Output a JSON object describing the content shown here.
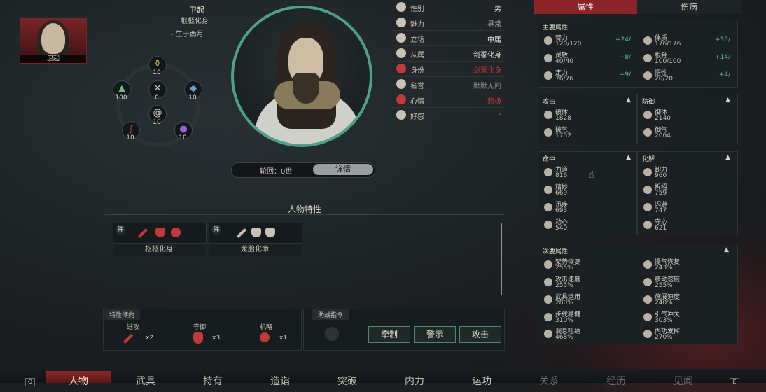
{
  "character": {
    "name": "卫起",
    "title": "枢柩化身",
    "birth": "-  生于酉月",
    "thumb_name": "卫起"
  },
  "wheel": [
    {
      "icon": "gourd-icon",
      "value": "10"
    },
    {
      "icon": "leaf-icon",
      "value": "100"
    },
    {
      "icon": "bird-icon",
      "value": "0"
    },
    {
      "icon": "gem-icon",
      "value": "10"
    },
    {
      "icon": "spiral-icon",
      "value": "10"
    },
    {
      "icon": "snake-icon",
      "value": "10"
    },
    {
      "icon": "flower-icon",
      "value": "10"
    }
  ],
  "reincarnation": {
    "label": "轮回：0世",
    "detail_button": "详情"
  },
  "info": [
    {
      "label": "性别",
      "value": "男",
      "color": "#e6e0d0"
    },
    {
      "label": "魅力",
      "value": "寻常",
      "color": "#c8c2b4"
    },
    {
      "label": "立场",
      "value": "中庸",
      "color": "#e6e0d0"
    },
    {
      "label": "从属",
      "value": "剑冢化身",
      "color": "#e6e0d0"
    },
    {
      "label": "身份",
      "value": "剑冢化身",
      "color": "#c0393b"
    },
    {
      "label": "名誉",
      "value": "默默无闻",
      "color": "#8a8a84"
    },
    {
      "label": "心情",
      "value": "悲极",
      "color": "#c0393b"
    },
    {
      "label": "好感",
      "value": "-",
      "color": "#8a8a84"
    }
  ],
  "traits": {
    "title": "人物特性",
    "cards": [
      {
        "badge": "殊",
        "name": "枢柩化身"
      },
      {
        "badge": "殊",
        "name": "龙胎化命"
      }
    ]
  },
  "tendency": {
    "header": "特性倾向",
    "items": [
      {
        "label": "进攻",
        "count": "x2"
      },
      {
        "label": "守御",
        "count": "x3"
      },
      {
        "label": "机略",
        "count": "x1"
      }
    ]
  },
  "command": {
    "header": "助战指令",
    "buttons": [
      "牵制",
      "警示",
      "攻击"
    ]
  },
  "tabs": {
    "attributes": "属性",
    "injury": "伤病"
  },
  "main_attrs": {
    "header": "主要属性",
    "items": [
      {
        "label": "膂力",
        "value": "120/120",
        "bonus": "+24/"
      },
      {
        "label": "体质",
        "value": "176/176",
        "bonus": "+35/"
      },
      {
        "label": "灵敏",
        "value": "40/40",
        "bonus": "+8/"
      },
      {
        "label": "根骨",
        "value": "100/100",
        "bonus": "+14/"
      },
      {
        "label": "定力",
        "value": "76/76",
        "bonus": "+9/"
      },
      {
        "label": "悟性",
        "value": "20/20",
        "bonus": "+4/"
      }
    ]
  },
  "attack": {
    "header": "攻击",
    "items": [
      {
        "label": "破体",
        "value": "1828"
      },
      {
        "label": "破气",
        "value": "1752"
      }
    ]
  },
  "defense": {
    "header": "防御",
    "items": [
      {
        "label": "御体",
        "value": "2140"
      },
      {
        "label": "御气",
        "value": "2064"
      }
    ]
  },
  "hit": {
    "header": "命中",
    "items": [
      {
        "label": "力道",
        "value": "816"
      },
      {
        "label": "精妙",
        "value": "669"
      },
      {
        "label": "迅疾",
        "value": "693"
      },
      {
        "label": "动心",
        "value": "540"
      }
    ]
  },
  "dodge": {
    "header": "化解",
    "items": [
      {
        "label": "卸力",
        "value": "960"
      },
      {
        "label": "拆招",
        "value": "759"
      },
      {
        "label": "闪避",
        "value": "747"
      },
      {
        "label": "守心",
        "value": "621"
      }
    ]
  },
  "secondary": {
    "header": "次要属性",
    "items": [
      {
        "label": "架势恢复",
        "value": "255%"
      },
      {
        "label": "提气恢复",
        "value": "243%"
      },
      {
        "label": "攻击速度",
        "value": "255%"
      },
      {
        "label": "移动速度",
        "value": "255%"
      },
      {
        "label": "武具运用",
        "value": "280%"
      },
      {
        "label": "施展速度",
        "value": "240%"
      },
      {
        "label": "步伐稳健",
        "value": "310%"
      },
      {
        "label": "引气冲关",
        "value": "303%"
      },
      {
        "label": "调息吐纳",
        "value": "468%"
      },
      {
        "label": "内功发挥",
        "value": "270%"
      }
    ]
  },
  "nav": {
    "key_left": "Q",
    "key_right": "E",
    "items": [
      "人物",
      "武具",
      "持有",
      "造诣",
      "突破",
      "内力",
      "运功",
      "关系",
      "经历",
      "见闻"
    ]
  }
}
